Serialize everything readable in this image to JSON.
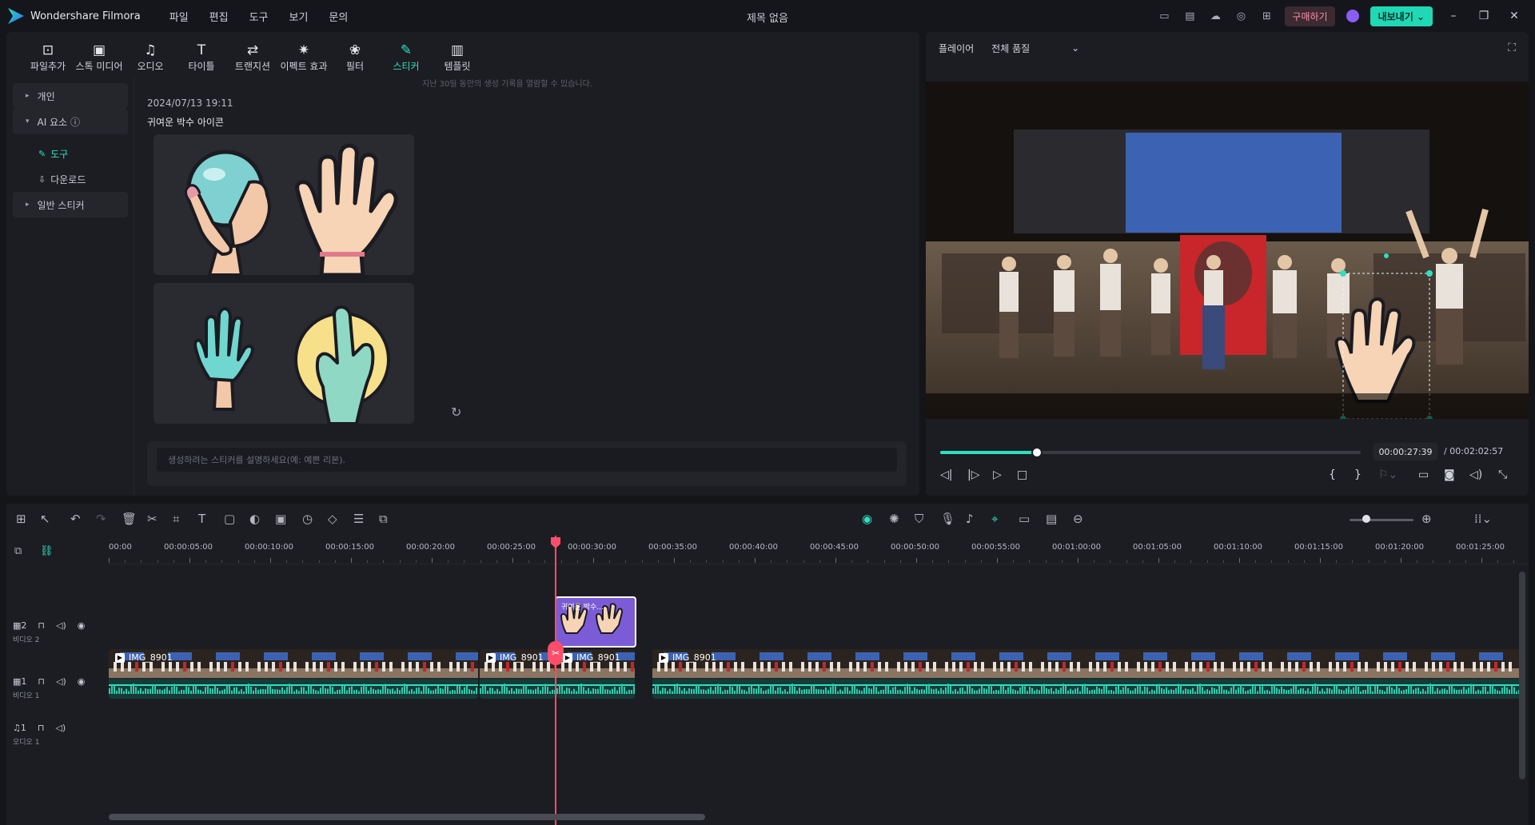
{
  "app": {
    "name": "Wondershare Filmora",
    "doc_title": "제목 없음"
  },
  "menu": [
    "파일",
    "편집",
    "도구",
    "보기",
    "문의"
  ],
  "titlebar": {
    "buy": "구매하기",
    "export": "내보내기 ⌄"
  },
  "toolbar": [
    {
      "icon": "import-icon",
      "glyph": "⊡",
      "label": "파일추가"
    },
    {
      "icon": "stock-media-icon",
      "glyph": "▣",
      "label": "스톡 미디어"
    },
    {
      "icon": "audio-icon",
      "glyph": "♫",
      "label": "오디오"
    },
    {
      "icon": "titles-icon",
      "glyph": "T",
      "label": "타이틀"
    },
    {
      "icon": "transition-icon",
      "glyph": "⇄",
      "label": "트랜지션"
    },
    {
      "icon": "effects-icon",
      "glyph": "✷",
      "label": "이펙트 효과"
    },
    {
      "icon": "filter-icon",
      "glyph": "❀",
      "label": "필터"
    },
    {
      "icon": "sticker-icon",
      "glyph": "✎",
      "label": "스티커",
      "active": true
    },
    {
      "icon": "template-icon",
      "glyph": "▥",
      "label": "템플릿"
    }
  ],
  "sidebar": {
    "items": [
      {
        "label": "개인",
        "arrow": "▸"
      },
      {
        "label": "AI 요소 ⓘ",
        "arrow": "▾"
      },
      {
        "label": "도구",
        "icon": "brush-icon",
        "active": true
      },
      {
        "label": "다운로드",
        "icon": "download-icon"
      },
      {
        "label": "일반 스티커",
        "arrow": "▸"
      }
    ]
  },
  "content": {
    "hint": "지난 30일 동안의 생성 기록을 열람할 수 있습니다.",
    "date": "2024/07/13 19:11",
    "prompt": "귀여운 박수 아이콘",
    "input_placeholder": "생성하려는 스티커를 설명하세요(예: 예쁜 리본)."
  },
  "player": {
    "label": "플레이어",
    "quality": "전체 품질",
    "current_time": "00:00:27:39",
    "total_time": "/ 00:02:02:57",
    "progress": 0.23
  },
  "ruler": [
    "00:00",
    "00:00:05:00",
    "00:00:10:00",
    "00:00:15:00",
    "00:00:20:00",
    "00:00:25:00",
    "00:00:30:00",
    "00:00:35:00",
    "00:00:40:00",
    "00:00:45:00",
    "00:00:50:00",
    "00:00:55:00",
    "00:01:00:00",
    "00:01:05:00",
    "00:01:10:00",
    "00:01:15:00",
    "00:01:20:00",
    "00:01:25:00"
  ],
  "tracks": {
    "video2": {
      "num": "2",
      "label": "비디오 2"
    },
    "video1": {
      "num": "1",
      "label": "비디오 1"
    },
    "audio1": {
      "num": "1",
      "label": "오디오 1"
    }
  },
  "clips": [
    {
      "name": "IMG_8901"
    },
    {
      "name": "IMG_8901"
    },
    {
      "name": "IMG_8901"
    },
    {
      "name": "IMG_8901"
    }
  ],
  "sticker_clip": {
    "name": "귀여운 박수..."
  },
  "colors": {
    "accent": "#2fe0c0",
    "playhead": "#ff4d6a",
    "sticker_clip": "#7b5cd6",
    "buy": "#ff8fa8"
  }
}
